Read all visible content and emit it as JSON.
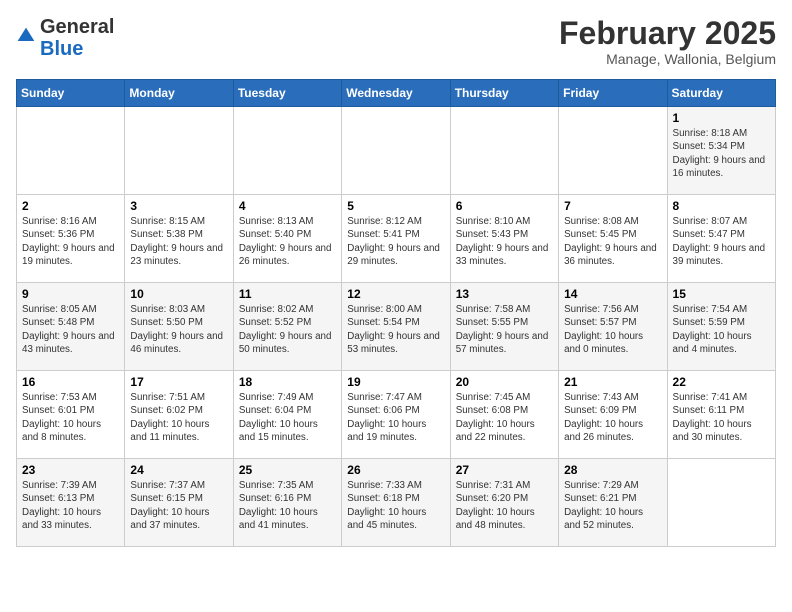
{
  "header": {
    "logo": {
      "general": "General",
      "blue": "Blue"
    },
    "title": "February 2025",
    "location": "Manage, Wallonia, Belgium"
  },
  "calendar": {
    "weekdays": [
      "Sunday",
      "Monday",
      "Tuesday",
      "Wednesday",
      "Thursday",
      "Friday",
      "Saturday"
    ],
    "weeks": [
      [
        {
          "day": "",
          "info": ""
        },
        {
          "day": "",
          "info": ""
        },
        {
          "day": "",
          "info": ""
        },
        {
          "day": "",
          "info": ""
        },
        {
          "day": "",
          "info": ""
        },
        {
          "day": "",
          "info": ""
        },
        {
          "day": "1",
          "info": "Sunrise: 8:18 AM\nSunset: 5:34 PM\nDaylight: 9 hours and 16 minutes."
        }
      ],
      [
        {
          "day": "2",
          "info": "Sunrise: 8:16 AM\nSunset: 5:36 PM\nDaylight: 9 hours and 19 minutes."
        },
        {
          "day": "3",
          "info": "Sunrise: 8:15 AM\nSunset: 5:38 PM\nDaylight: 9 hours and 23 minutes."
        },
        {
          "day": "4",
          "info": "Sunrise: 8:13 AM\nSunset: 5:40 PM\nDaylight: 9 hours and 26 minutes."
        },
        {
          "day": "5",
          "info": "Sunrise: 8:12 AM\nSunset: 5:41 PM\nDaylight: 9 hours and 29 minutes."
        },
        {
          "day": "6",
          "info": "Sunrise: 8:10 AM\nSunset: 5:43 PM\nDaylight: 9 hours and 33 minutes."
        },
        {
          "day": "7",
          "info": "Sunrise: 8:08 AM\nSunset: 5:45 PM\nDaylight: 9 hours and 36 minutes."
        },
        {
          "day": "8",
          "info": "Sunrise: 8:07 AM\nSunset: 5:47 PM\nDaylight: 9 hours and 39 minutes."
        }
      ],
      [
        {
          "day": "9",
          "info": "Sunrise: 8:05 AM\nSunset: 5:48 PM\nDaylight: 9 hours and 43 minutes."
        },
        {
          "day": "10",
          "info": "Sunrise: 8:03 AM\nSunset: 5:50 PM\nDaylight: 9 hours and 46 minutes."
        },
        {
          "day": "11",
          "info": "Sunrise: 8:02 AM\nSunset: 5:52 PM\nDaylight: 9 hours and 50 minutes."
        },
        {
          "day": "12",
          "info": "Sunrise: 8:00 AM\nSunset: 5:54 PM\nDaylight: 9 hours and 53 minutes."
        },
        {
          "day": "13",
          "info": "Sunrise: 7:58 AM\nSunset: 5:55 PM\nDaylight: 9 hours and 57 minutes."
        },
        {
          "day": "14",
          "info": "Sunrise: 7:56 AM\nSunset: 5:57 PM\nDaylight: 10 hours and 0 minutes."
        },
        {
          "day": "15",
          "info": "Sunrise: 7:54 AM\nSunset: 5:59 PM\nDaylight: 10 hours and 4 minutes."
        }
      ],
      [
        {
          "day": "16",
          "info": "Sunrise: 7:53 AM\nSunset: 6:01 PM\nDaylight: 10 hours and 8 minutes."
        },
        {
          "day": "17",
          "info": "Sunrise: 7:51 AM\nSunset: 6:02 PM\nDaylight: 10 hours and 11 minutes."
        },
        {
          "day": "18",
          "info": "Sunrise: 7:49 AM\nSunset: 6:04 PM\nDaylight: 10 hours and 15 minutes."
        },
        {
          "day": "19",
          "info": "Sunrise: 7:47 AM\nSunset: 6:06 PM\nDaylight: 10 hours and 19 minutes."
        },
        {
          "day": "20",
          "info": "Sunrise: 7:45 AM\nSunset: 6:08 PM\nDaylight: 10 hours and 22 minutes."
        },
        {
          "day": "21",
          "info": "Sunrise: 7:43 AM\nSunset: 6:09 PM\nDaylight: 10 hours and 26 minutes."
        },
        {
          "day": "22",
          "info": "Sunrise: 7:41 AM\nSunset: 6:11 PM\nDaylight: 10 hours and 30 minutes."
        }
      ],
      [
        {
          "day": "23",
          "info": "Sunrise: 7:39 AM\nSunset: 6:13 PM\nDaylight: 10 hours and 33 minutes."
        },
        {
          "day": "24",
          "info": "Sunrise: 7:37 AM\nSunset: 6:15 PM\nDaylight: 10 hours and 37 minutes."
        },
        {
          "day": "25",
          "info": "Sunrise: 7:35 AM\nSunset: 6:16 PM\nDaylight: 10 hours and 41 minutes."
        },
        {
          "day": "26",
          "info": "Sunrise: 7:33 AM\nSunset: 6:18 PM\nDaylight: 10 hours and 45 minutes."
        },
        {
          "day": "27",
          "info": "Sunrise: 7:31 AM\nSunset: 6:20 PM\nDaylight: 10 hours and 48 minutes."
        },
        {
          "day": "28",
          "info": "Sunrise: 7:29 AM\nSunset: 6:21 PM\nDaylight: 10 hours and 52 minutes."
        },
        {
          "day": "",
          "info": ""
        }
      ]
    ]
  }
}
